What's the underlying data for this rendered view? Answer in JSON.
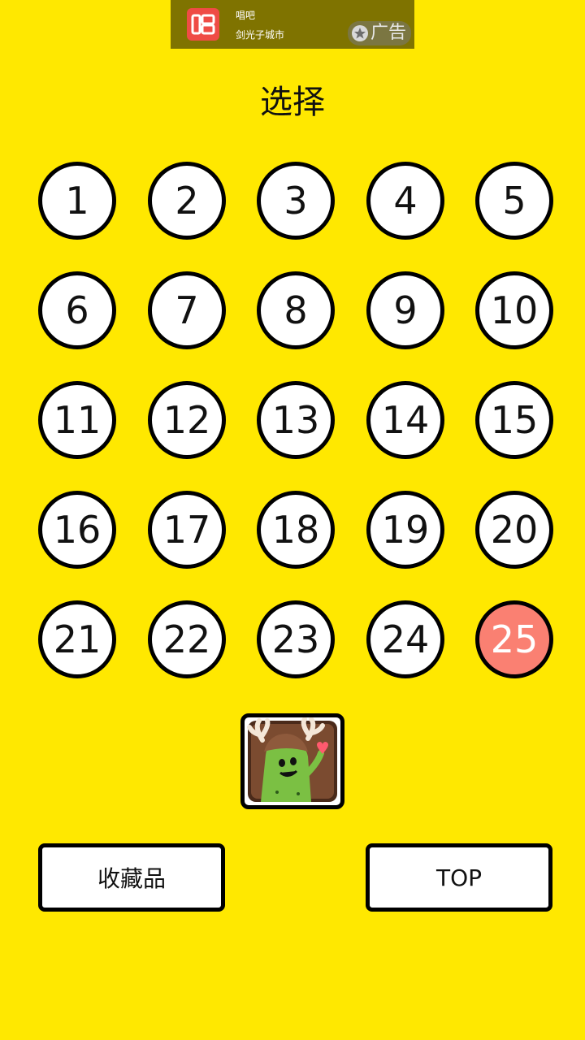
{
  "ad": {
    "app_name": "唱吧",
    "tagline": "剑光子城市",
    "tag_label": "广告"
  },
  "title": "选择",
  "levels": [
    "1",
    "2",
    "3",
    "4",
    "5",
    "6",
    "7",
    "8",
    "9",
    "10",
    "11",
    "12",
    "13",
    "14",
    "15",
    "16",
    "17",
    "18",
    "19",
    "20",
    "21",
    "22",
    "23",
    "24",
    "25"
  ],
  "current_level": "25",
  "buttons": {
    "collection": "收藏品",
    "top": "TOP"
  },
  "colors": {
    "background": "#FFE800",
    "current_level": "#FA8072",
    "ad_background": "#7f7300"
  },
  "icons": {
    "ad_app": "microphone-app-icon",
    "ad_tag": "star-icon",
    "character": "green-bean-character"
  }
}
